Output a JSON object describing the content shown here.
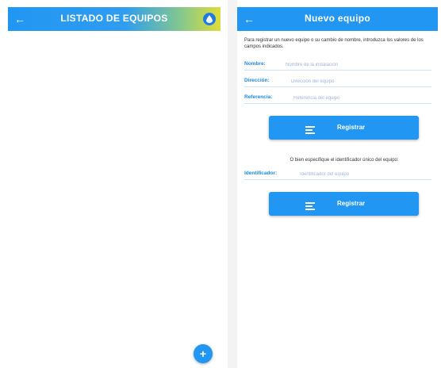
{
  "left_screen": {
    "title": "LISTADO DE EQUIPOS",
    "back_glyph": "←",
    "header_action_icon": "drop-icon",
    "fab_glyph": "+"
  },
  "right_screen": {
    "title": "Nuevo equipo",
    "back_glyph": "←",
    "intro_text": "Para registrar un nuevo equipo o su cambio de nombre, introduzca los valores de los campos indicados.",
    "fields": {
      "nombre": {
        "label": "Nombre:",
        "placeholder": "Nombre de la instalación"
      },
      "direccion": {
        "label": "Dirección:",
        "placeholder": "Dirección del equipo"
      },
      "referencia": {
        "label": "Referencia:",
        "placeholder": "Referencia del equipo"
      },
      "identificador": {
        "label": "Identificador:",
        "placeholder": "Identificador del equipo"
      }
    },
    "register_label": "Registrar",
    "identifier_note": "O bien especifique el identificador único del equipo:",
    "button_icon": "list-icon"
  },
  "colors": {
    "primary": "#2196f3",
    "gradient_end": "#e2dc3a",
    "label_blue": "#1e88e5"
  }
}
